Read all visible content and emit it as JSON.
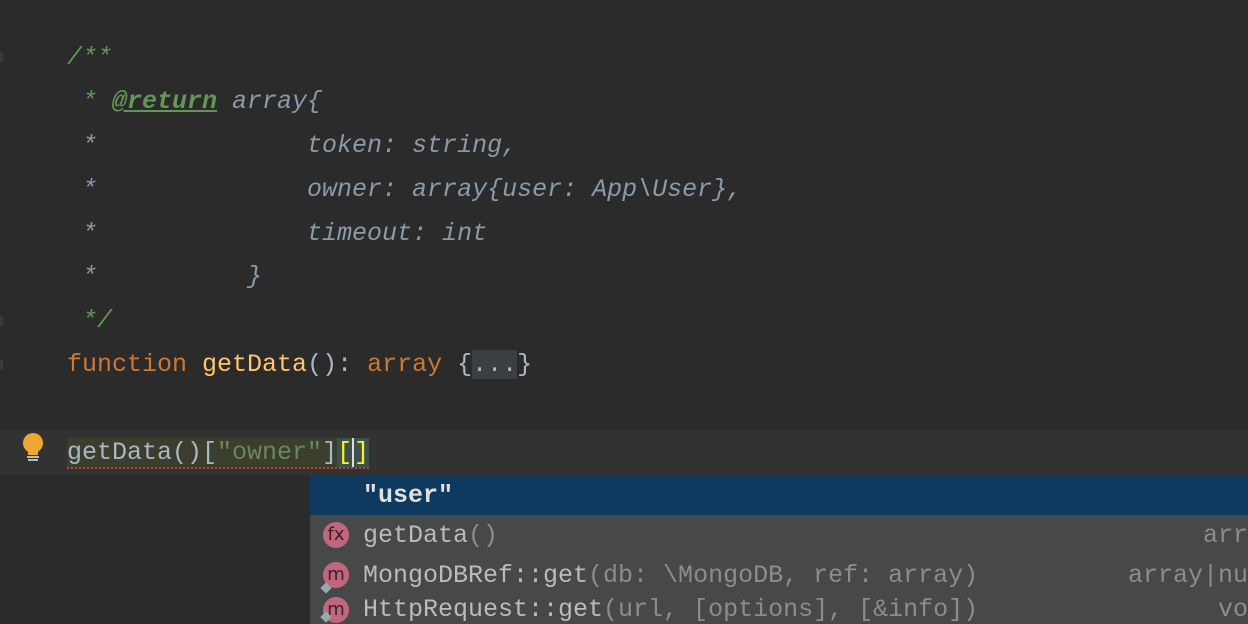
{
  "editor": {
    "doc_open": "/**",
    "doc_star": " * ",
    "doc_tag": "@return",
    "doc_return_type": " array{",
    "doc_line_token": " *              token: string,",
    "doc_line_owner": " *              owner: array{user: App\\User},",
    "doc_line_timeout": " *              timeout: int",
    "doc_line_close_brace": " *          }",
    "doc_close": " */",
    "func_keyword": "function",
    "func_name": "getData",
    "func_parens": "(): ",
    "func_return_type": "array",
    "func_open": " {",
    "func_folded": "...",
    "func_close": "}",
    "current_line": {
      "call": "getData()[",
      "string": "\"owner\"",
      "close": "]",
      "open_bracket": "[",
      "close_bracket": "]"
    }
  },
  "completion_popup": {
    "items": [
      {
        "icon": "",
        "label": "\"user\"",
        "params": "",
        "type": "",
        "selected": true
      },
      {
        "icon": "fx",
        "label": "getData",
        "params": "()",
        "type": "arr"
      },
      {
        "icon": "m",
        "label": "MongoDBRef::get",
        "params": "(db: \\MongoDB, ref: array)",
        "type": "array|nu"
      },
      {
        "icon": "m",
        "label": "HttpRequest::get",
        "params": "(url, [options], [&info])",
        "type": "vo"
      }
    ]
  },
  "colors": {
    "background": "#2b2b2b",
    "comment": "#629755",
    "keyword": "#cc7832",
    "function": "#ffc66d",
    "selection": "#0d3a5e",
    "popup": "#46484a"
  }
}
